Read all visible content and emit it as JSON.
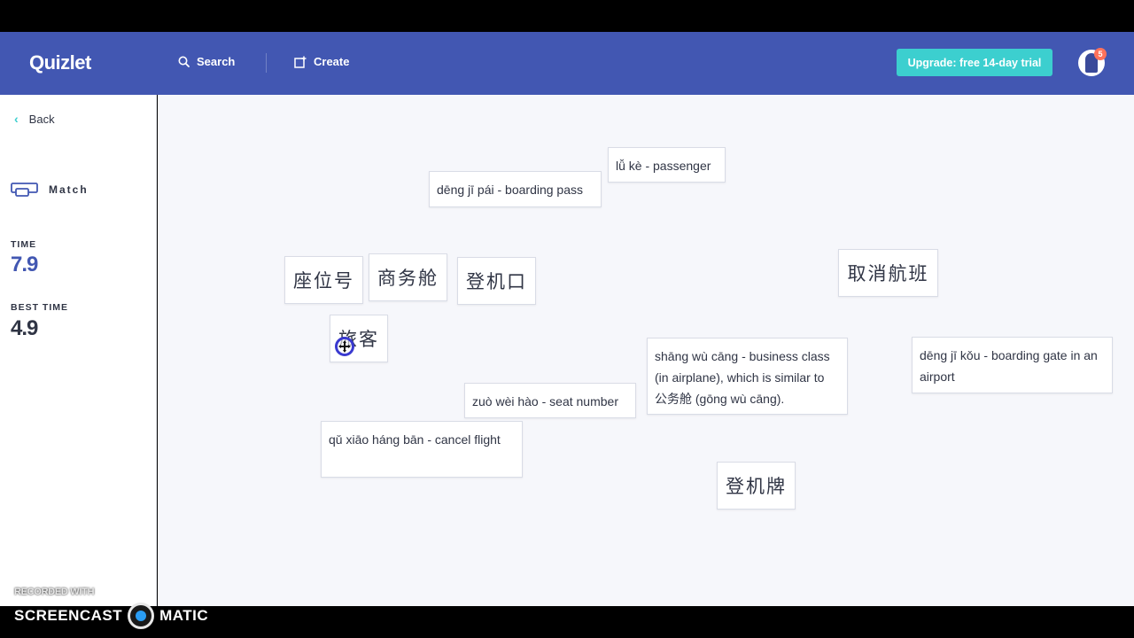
{
  "header": {
    "logo": "Quizlet",
    "search_label": "Search",
    "create_label": "Create",
    "upgrade_label": "Upgrade: free 14-day trial",
    "notification_count": "5",
    "colors": {
      "bar": "#4257b2",
      "upgrade": "#3ccfcf",
      "badge": "#ff725b"
    }
  },
  "sidebar": {
    "back_label": "Back",
    "mode_label": "Match",
    "time_label": "TIME",
    "time_value": "7.9",
    "best_label": "BEST TIME",
    "best_value": "4.9"
  },
  "tiles": {
    "lvke_def": "lǚ kè - passenger",
    "dengjipai_def": "dēng jī pái - boarding pass",
    "zuoweihao_zh": "座位号",
    "shangwucang_zh": "商务舱",
    "dengjikou_zh": "登机口",
    "quxiaohangban_zh": "取消航班",
    "lvke_zh": "旅客",
    "shangwucang_def": "shāng wù cāng - business class (in airplane), which is similar to 公务舱 (gōng wù cāng).",
    "dengjikou_def": "dēng jī kǒu - boarding gate in an airport",
    "zuoweihao_def": "zuò wèi hào - seat number",
    "quxiaohangban_def": "qǔ xiāo háng bān - cancel flight",
    "dengjipai_zh": "登机牌"
  },
  "watermark": {
    "line1": "RECORDED WITH",
    "brand_left": "SCREENCAST",
    "brand_right": "MATIC"
  }
}
